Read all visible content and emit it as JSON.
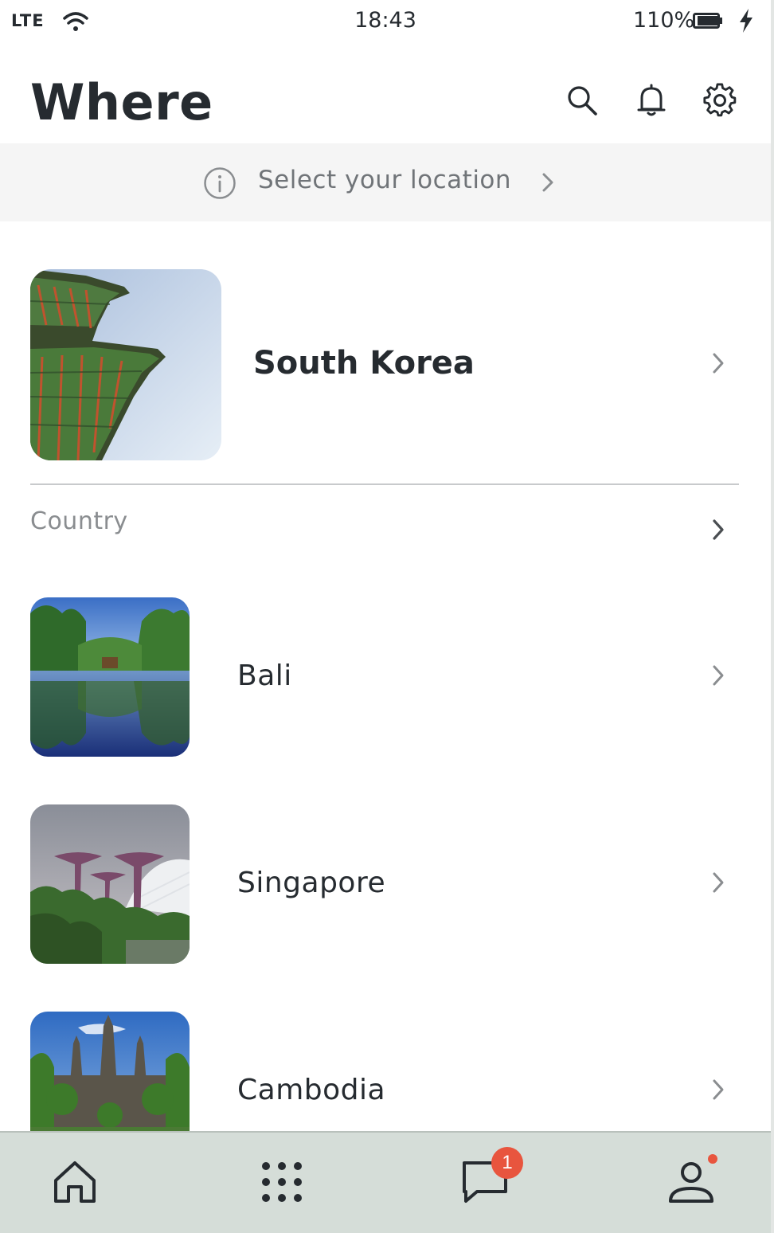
{
  "status_bar": {
    "network": "LTE",
    "time": "18:43",
    "battery": "110%"
  },
  "header": {
    "title": "Where",
    "icons": [
      "search-icon",
      "bell-icon",
      "gear-icon"
    ]
  },
  "location_bar": {
    "label": "Select your location"
  },
  "featured": {
    "title": "South Korea",
    "image": "korean-palace-roof"
  },
  "section": {
    "label": "Country"
  },
  "countries": [
    {
      "label": "Bali",
      "image": "lake-reflection"
    },
    {
      "label": "Singapore",
      "image": "supertree-gardens"
    },
    {
      "label": "Cambodia",
      "image": "angkor-temple"
    }
  ],
  "bottom_nav": {
    "items": [
      "home-icon",
      "apps-grid-icon",
      "chat-icon",
      "profile-icon"
    ],
    "chat_badge": "1"
  },
  "colors": {
    "text": "#262b30",
    "location_bar_bg": "#f5f5f5",
    "nav_bg": "#d5ddd8",
    "badge": "#e8553e"
  }
}
